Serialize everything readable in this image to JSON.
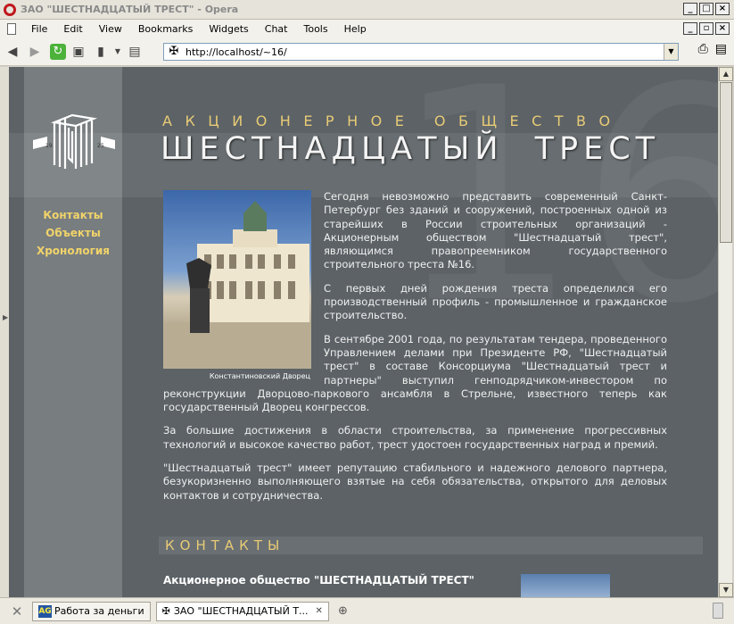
{
  "window": {
    "title": "ЗАО \"ШЕСТНАДЦАТЫЙ ТРЕСТ\" - Opera"
  },
  "menu": [
    "File",
    "Edit",
    "View",
    "Bookmarks",
    "Widgets",
    "Chat",
    "Tools",
    "Help"
  ],
  "address": {
    "url": "http://localhost/~16/"
  },
  "page": {
    "over_title": "АКЦИОНЕРНОЕ ОБЩЕСТВО",
    "main_title": "ШЕСТНАДЦАТЫЙ ТРЕСТ",
    "watermark": "16",
    "logo_years": [
      "19",
      "25"
    ],
    "nav": [
      "Контакты",
      "Объекты",
      "Хронология"
    ],
    "photo_caption": "Константиновский Дворец",
    "paragraphs": [
      "Сегодня невозможно представить современный Санкт-Петербург без зданий и сооружений, построенных одной из старейших в России строительных организаций - Акционерным обществом \"Шестнадцатый трест\", являющимся правопреемником государственного строительного треста №16.",
      "С первых дней рождения треста определился его производственный профиль - промышленное и гражданское строительство.",
      "В сентябре 2001 года, по результатам тендера, проведенного Управлением делами при Президенте РФ, \"Шестнадцатый трест\" в составе Консорциума \"Шестнадцатый трест и партнеры\" выступил генподрядчиком-инвестором по реконструкции Дворцово-паркового ансамбля в Стрельне, известного теперь как государственный Дворец конгрессов.",
      "За большие достижения в области строительства, за применение прогрессивных технологий и высокое качество работ, трест удостоен государственных наград и премий.",
      "\"Шестнадцатый трест\" имеет репутацию стабильного и надежного делового партнера, безукоризненно выполняющего взятые на себя обязательства, открытого для деловых контактов и сотрудничества."
    ],
    "contacts_title": "КОНТАКТЫ",
    "company_name": "Акционерное общество \"ШЕСТНАДЦАТЫЙ ТРЕСТ\""
  },
  "tabs": [
    {
      "icon": "AG",
      "label": "Работа за деньги"
    },
    {
      "label": "ЗАО \"ШЕСТНАДЦАТЫЙ Т..."
    }
  ],
  "colors": {
    "accent": "#e8cb76",
    "page_bg": "#5c6266",
    "sidebar_bg": "#787d80"
  }
}
